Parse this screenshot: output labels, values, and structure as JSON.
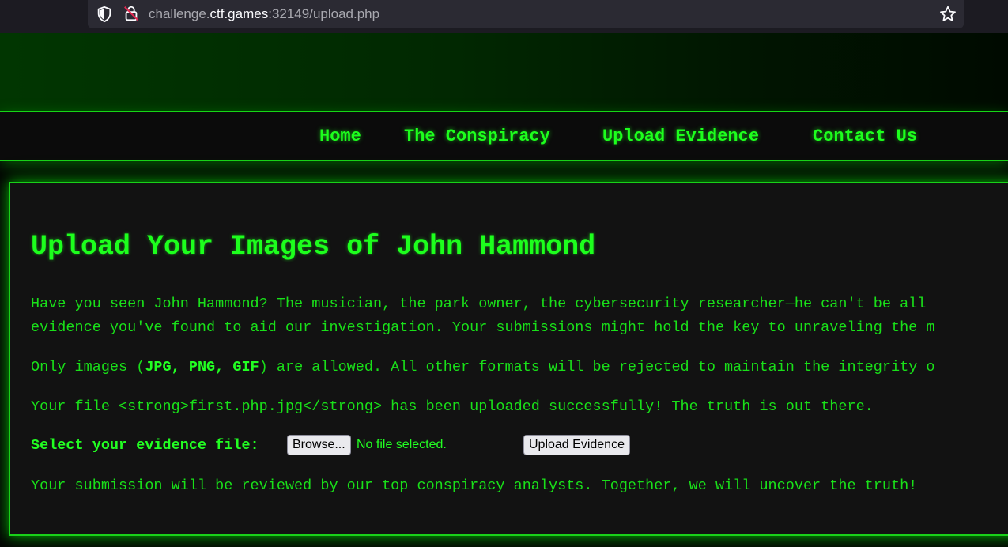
{
  "browser": {
    "url_prefix": "challenge.",
    "url_host": "ctf.games",
    "url_suffix": ":32149/upload.php"
  },
  "nav": {
    "items": [
      "Home",
      "The Conspiracy",
      "Upload Evidence",
      "Contact Us"
    ]
  },
  "main": {
    "heading": "Upload Your Images of John Hammond",
    "intro_line1": "Have you seen John Hammond? The musician, the park owner, the cybersecurity researcher—he can't be all",
    "intro_line2": "evidence you've found to aid our investigation. Your submissions might hold the key to unraveling the m",
    "formats_prefix": "Only images (",
    "formats_bold": "JPG, PNG, GIF",
    "formats_suffix": ") are allowed. All other formats will be rejected to maintain the integrity o",
    "status_message": "Your file <strong>first.php.jpg</strong> has been uploaded successfully! The truth is out there.",
    "file_label": "Select your evidence file:",
    "browse_label": "Browse...",
    "no_file_text": "No file selected.",
    "submit_label": "Upload Evidence",
    "footer_text": "Your submission will be reviewed by our top conspiracy analysts. Together, we will uncover the truth!"
  },
  "colors": {
    "accent": "#1dff1d",
    "background": "#121212"
  }
}
